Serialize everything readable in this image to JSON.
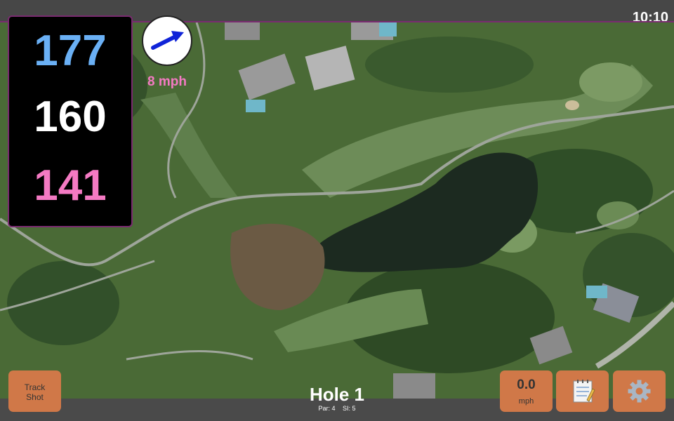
{
  "status": {
    "time": "10:10"
  },
  "yardages": {
    "back": "177",
    "middle": "160",
    "front": "141"
  },
  "wind": {
    "speed_label": "8 mph",
    "direction_icon": "wind-arrow-icon"
  },
  "hole": {
    "title": "Hole 1",
    "par": "Par: 4",
    "stroke_index": "SI: 5"
  },
  "buttons": {
    "track_shot": {
      "line1": "Track",
      "line2": "Shot"
    },
    "wind_speed": {
      "value": "0.0",
      "unit": "mph"
    },
    "notes_icon": "notepad-icon",
    "settings_icon": "gear-icon"
  },
  "colors": {
    "back_yardage": "#6ab0f5",
    "middle_yardage": "#ffffff",
    "front_yardage": "#f47ac3",
    "button": "#d07848",
    "accent_border": "#7a2b70"
  }
}
